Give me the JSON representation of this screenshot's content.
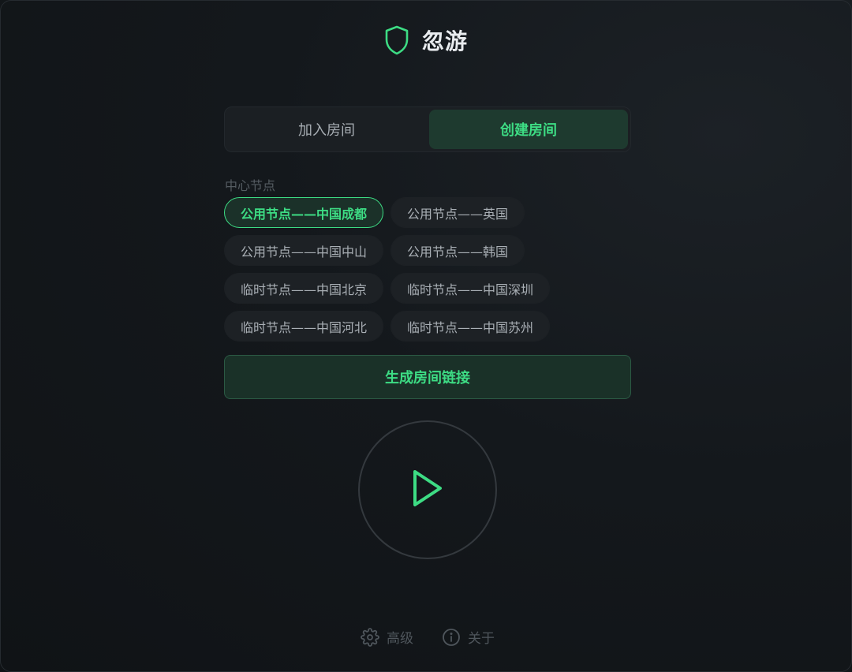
{
  "app": {
    "title": "忽游",
    "accent_color": "#3ddc84",
    "logo_icon": "shield-icon"
  },
  "tabs": [
    {
      "label": "加入房间",
      "active": false
    },
    {
      "label": "创建房间",
      "active": true
    }
  ],
  "nodes": {
    "section_label": "中心节点",
    "items": [
      {
        "label": "公用节点——中国成都",
        "selected": true
      },
      {
        "label": "公用节点——英国",
        "selected": false
      },
      {
        "label": "公用节点——中国中山",
        "selected": false
      },
      {
        "label": "公用节点——韩国",
        "selected": false
      },
      {
        "label": "临时节点——中国北京",
        "selected": false
      },
      {
        "label": "临时节点——中国深圳",
        "selected": false
      },
      {
        "label": "临时节点——中国河北",
        "selected": false
      },
      {
        "label": "临时节点——中国苏州",
        "selected": false
      }
    ]
  },
  "generate_button": {
    "label": "生成房间链接"
  },
  "play_button": {
    "icon": "play-icon"
  },
  "footer": {
    "advanced": {
      "label": "高级",
      "icon": "gear-icon"
    },
    "about": {
      "label": "关于",
      "icon": "info-icon"
    }
  }
}
